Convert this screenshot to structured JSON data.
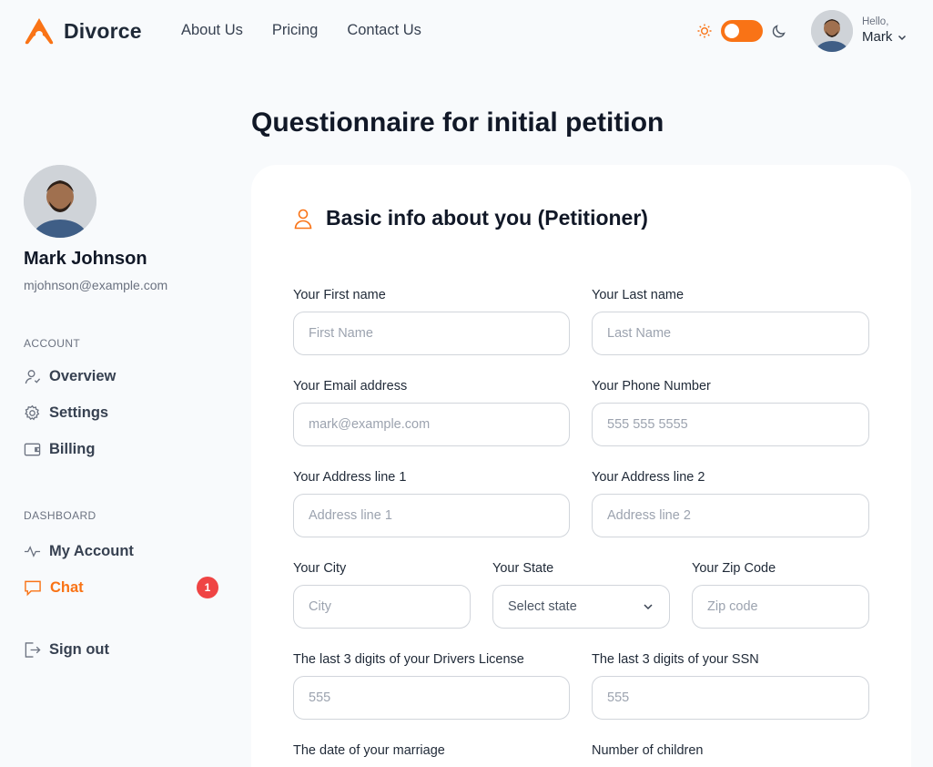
{
  "brand": {
    "name": "Divorce",
    "color": "#f97316"
  },
  "nav": [
    "About Us",
    "Pricing",
    "Contact Us"
  ],
  "header_user": {
    "greeting": "Hello,",
    "name": "Mark"
  },
  "profile": {
    "name": "Mark Johnson",
    "email": "mjohnson@example.com"
  },
  "sidebar": {
    "account_title": "ACCOUNT",
    "account_items": [
      {
        "label": "Overview",
        "icon": "user-icon"
      },
      {
        "label": "Settings",
        "icon": "gear-icon"
      },
      {
        "label": "Billing",
        "icon": "wallet-icon"
      }
    ],
    "dashboard_title": "DASHBOARD",
    "dashboard_items": [
      {
        "label": "My Account",
        "icon": "activity-icon"
      },
      {
        "label": "Chat",
        "icon": "chat-icon",
        "badge": "1",
        "active": true
      }
    ],
    "signout": "Sign out"
  },
  "page_title": "Questionnaire for initial petition",
  "section_title": "Basic info about you (Petitioner)",
  "fields": {
    "first_name": {
      "label": "Your First name",
      "placeholder": "First Name"
    },
    "last_name": {
      "label": "Your Last name",
      "placeholder": "Last Name"
    },
    "email": {
      "label": "Your Email address",
      "placeholder": "mark@example.com"
    },
    "phone": {
      "label": "Your Phone Number",
      "placeholder": "555 555 5555"
    },
    "address1": {
      "label": "Your Address line 1",
      "placeholder": "Address line 1"
    },
    "address2": {
      "label": "Your Address line 2",
      "placeholder": "Address line 2"
    },
    "city": {
      "label": "Your City",
      "placeholder": "City"
    },
    "state": {
      "label": "Your State",
      "value": "Select state"
    },
    "zip": {
      "label": "Your Zip Code",
      "placeholder": "Zip code"
    },
    "license": {
      "label": "The last 3 digits of your Drivers License",
      "placeholder": "555"
    },
    "ssn": {
      "label": "The last 3 digits of your SSN",
      "placeholder": "555"
    },
    "marriage_date": {
      "label": "The date of your marriage"
    },
    "children": {
      "label": "Number of children"
    }
  }
}
